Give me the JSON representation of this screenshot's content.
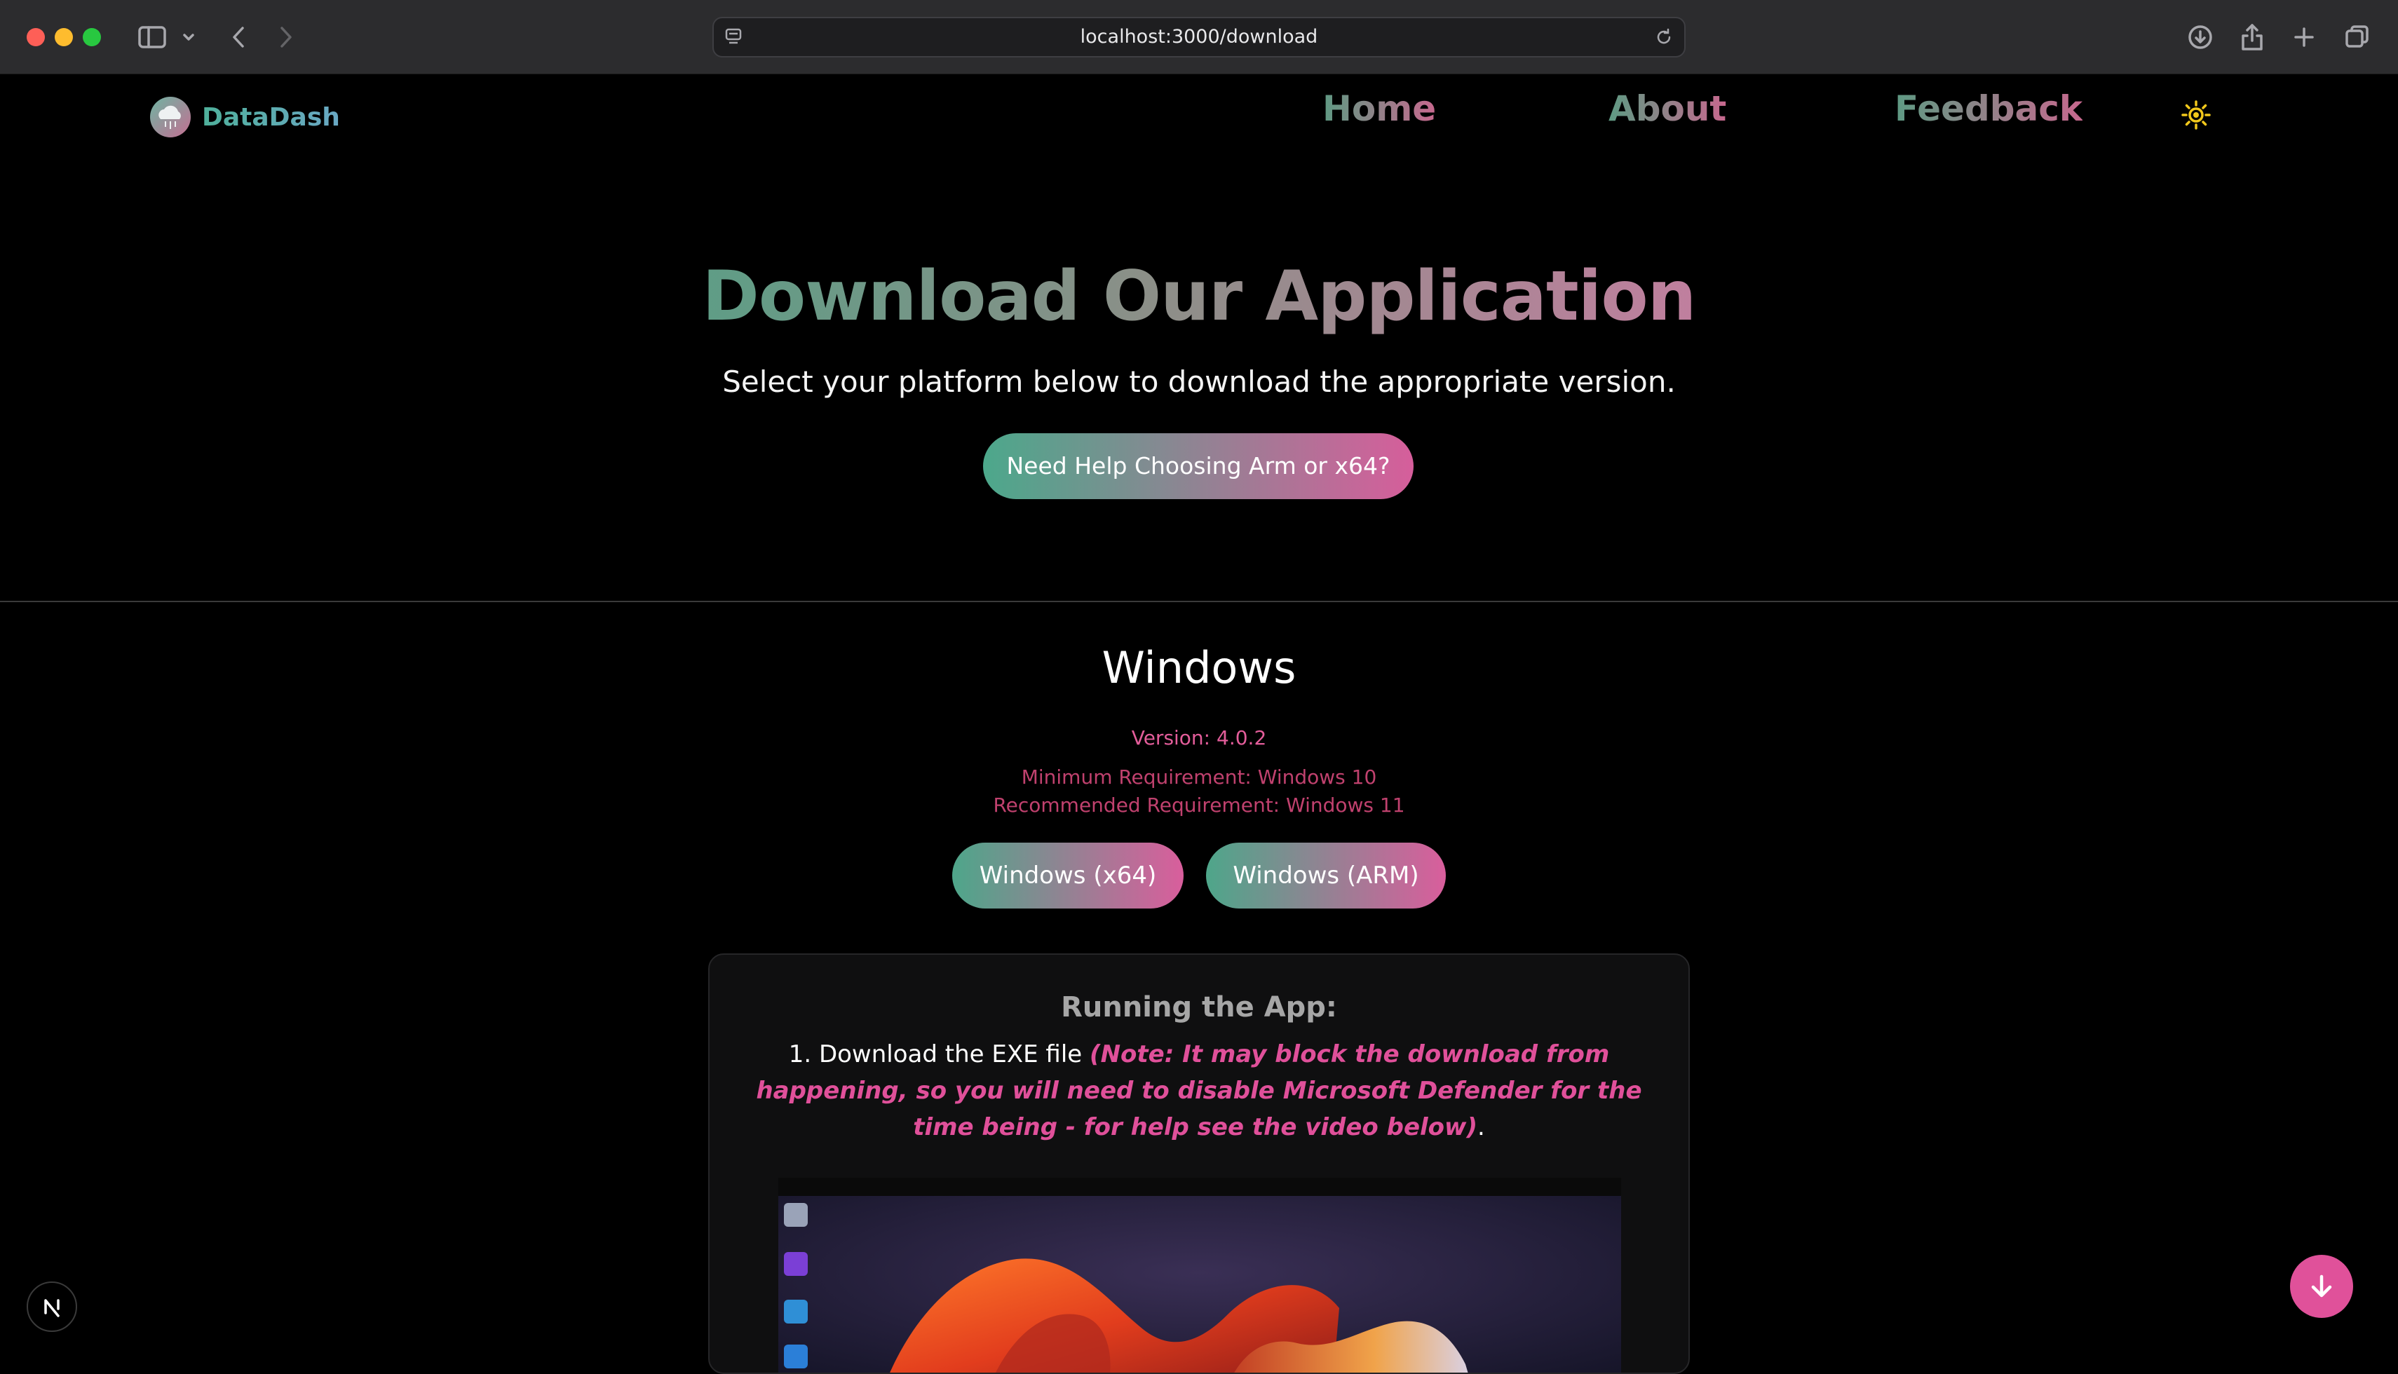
{
  "browser": {
    "url": "localhost:3000/download"
  },
  "nav": {
    "brand": "DataDash",
    "links": [
      "Home",
      "About",
      "Feedback"
    ]
  },
  "hero": {
    "title": "Download Our Application",
    "subtitle": "Select your platform below to download the appropriate version.",
    "help_button": "Need Help Choosing Arm or x64?"
  },
  "windows": {
    "title": "Windows",
    "version": "Version: 4.0.2",
    "min_requirement": "Minimum Requirement: Windows 10",
    "recommended_requirement": "Recommended Requirement: Windows 11",
    "buttons": [
      "Windows (x64)",
      "Windows (ARM)"
    ]
  },
  "running": {
    "title": "Running the App:",
    "step1_prefix": "1. Download the EXE file ",
    "step1_note": "(Note: It may block the download from happening, so you will need to disable Microsoft Defender for the time being - for help see the video below)",
    "step1_suffix": "."
  },
  "colors": {
    "accent_pink": "#e0519a",
    "accent_green": "#4ea68a",
    "background": "#000000"
  },
  "icons": {
    "next_badge": "N",
    "scroll": "arrow-down-icon",
    "theme": "sun-icon"
  }
}
